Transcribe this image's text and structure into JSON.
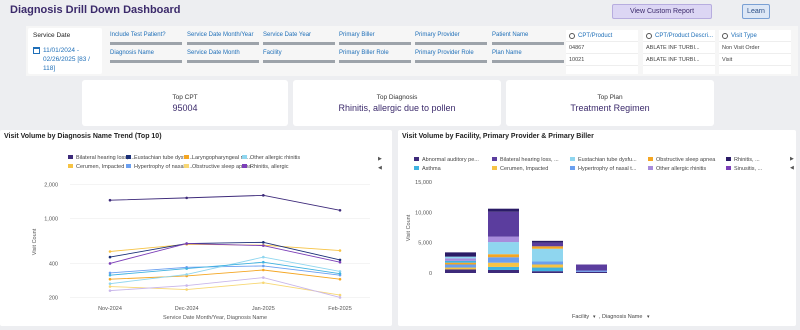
{
  "header": {
    "title": "Diagnosis Drill Down Dashboard",
    "custom_report": "View Custom Report",
    "learn": "Learn"
  },
  "filters": {
    "service_date": {
      "label": "Service Date",
      "value_line1": "11/01/2024 -",
      "value_line2": "02/26/2025 [83 / 118]"
    },
    "row1": [
      "Include Test Patient?",
      "Service Date Month/Year",
      "Service Date Year",
      "Primary Biller",
      "Primary Provider",
      "Patient Name"
    ],
    "row2": [
      "Diagnosis Name",
      "Service Date Month",
      "Facility",
      "Primary Biller Role",
      "Primary Provider Role",
      "Plan Name"
    ],
    "lists": [
      {
        "label": "CPT/Product",
        "items": [
          "04867",
          "10021"
        ]
      },
      {
        "label": "CPT/Product Descri...",
        "items": [
          "ABLATE INF TURBI...",
          "ABLATE INF TURBI..."
        ]
      },
      {
        "label": "Visit Type",
        "items": [
          "Non Visit Order",
          "Visit"
        ]
      }
    ]
  },
  "kpis": [
    {
      "label": "Top CPT",
      "value": "95004"
    },
    {
      "label": "Top Diagnosis",
      "value": "Rhinitis, allergic due to pollen"
    },
    {
      "label": "Top Plan",
      "value": "Treatment Regimen"
    }
  ],
  "colors": {
    "accent": "#3b2a6b",
    "link": "#1f6fb8"
  },
  "chart_data": [
    {
      "type": "line",
      "title": "Visit Volume by Diagnosis Name Trend (Top 10)",
      "xlabel": "Service Date Month/Year, Diagnosis Name",
      "ylabel": "Visit Count",
      "categories": [
        "Nov-2024",
        "Dec-2024",
        "Jan-2025",
        "Feb-2025"
      ],
      "y_ticks": [
        "2,000",
        "1,000",
        "400",
        "200"
      ],
      "scale": "log",
      "ylim": [
        190,
        2100
      ],
      "legend_placement": "top",
      "series": [
        {
          "name": "Bilateral hearing loss, ...",
          "color": "#3d2a7a",
          "values": [
            1450,
            1520,
            1600,
            1180
          ]
        },
        {
          "name": "Cerumen, Impacted",
          "color": "#f6c344",
          "values": [
            510,
            590,
            580,
            520
          ]
        },
        {
          "name": "Eustachian tube dysfu...",
          "color": "#1a2f77",
          "values": [
            455,
            600,
            615,
            430
          ]
        },
        {
          "name": "Hypertrophy of nasal t...",
          "color": "#6a9ff0",
          "values": [
            330,
            370,
            380,
            315
          ]
        },
        {
          "name": "Laryngopharyngeal ref...",
          "color": "#f4a623",
          "values": [
            290,
            310,
            350,
            290
          ]
        },
        {
          "name": "Obstructive sleep apnea",
          "color": "#f7d774",
          "values": [
            250,
            235,
            270,
            210
          ]
        },
        {
          "name": "Other allergic rhinitis",
          "color": "#8fd6ef",
          "values": [
            265,
            320,
            455,
            340
          ]
        },
        {
          "name": "Rhinitis, allergic",
          "color": "#7c3fb8",
          "values": [
            400,
            600,
            575,
            410
          ]
        },
        {
          "name": "",
          "color": "#3fb2e0",
          "values": [
            315,
            360,
            410,
            325
          ]
        },
        {
          "name": "",
          "color": "#c9b7ea",
          "values": [
            230,
            255,
            300,
            200
          ]
        }
      ]
    },
    {
      "type": "bar",
      "title": "Visit Volume by Facility, Primary Provider & Primary Biller",
      "xlabel": "Facility, Diagnosis Name",
      "ylabel": "Visit Count",
      "ylim": [
        0,
        15000
      ],
      "y_ticks": [
        "15,000",
        "10,000",
        "5,000",
        "0"
      ],
      "legend_placement": "top",
      "legend": [
        {
          "name": "Abnormal auditory pe...",
          "color": "#3d2a7a"
        },
        {
          "name": "Asthma",
          "color": "#3fb2e0"
        },
        {
          "name": "Bilateral hearing loss, ...",
          "color": "#5b3d9e"
        },
        {
          "name": "Cerumen, Impacted",
          "color": "#f6c344"
        },
        {
          "name": "Eustachian tube dysfu...",
          "color": "#8fd6ef"
        },
        {
          "name": "Hypertrophy of nasal t...",
          "color": "#6a9ff0"
        },
        {
          "name": "Obstructive sleep apnea",
          "color": "#f4a623"
        },
        {
          "name": "Other allergic rhinitis",
          "color": "#a88cdc"
        },
        {
          "name": "Rhinitis, ...",
          "color": "#2a1b66"
        },
        {
          "name": "Sinusitis, ...",
          "color": "#7c3fb8"
        }
      ],
      "stacks": [
        [
          {
            "color": "#3d2a7a",
            "value": 600
          },
          {
            "color": "#f6c344",
            "value": 300
          },
          {
            "color": "#6a9ff0",
            "value": 500
          },
          {
            "color": "#f4a623",
            "value": 300
          },
          {
            "color": "#3fb2e0",
            "value": 300
          },
          {
            "color": "#a88cdc",
            "value": 400
          },
          {
            "color": "#8fd6ef",
            "value": 300
          },
          {
            "color": "#2a1b66",
            "value": 700
          }
        ],
        [
          {
            "color": "#3d2a7a",
            "value": 500
          },
          {
            "color": "#3fb2e0",
            "value": 500
          },
          {
            "color": "#f6c344",
            "value": 700
          },
          {
            "color": "#6a9ff0",
            "value": 900
          },
          {
            "color": "#f4a623",
            "value": 500
          },
          {
            "color": "#8fd6ef",
            "value": 2000
          },
          {
            "color": "#a88cdc",
            "value": 900
          },
          {
            "color": "#5b3d9e",
            "value": 4100
          },
          {
            "color": "#2a1b66",
            "value": 500
          }
        ],
        [
          {
            "color": "#3d2a7a",
            "value": 300
          },
          {
            "color": "#3fb2e0",
            "value": 600
          },
          {
            "color": "#f6c344",
            "value": 500
          },
          {
            "color": "#6a9ff0",
            "value": 500
          },
          {
            "color": "#8fd6ef",
            "value": 2100
          },
          {
            "color": "#f4a623",
            "value": 400
          },
          {
            "color": "#5b3d9e",
            "value": 600
          },
          {
            "color": "#2a1b66",
            "value": 300
          }
        ],
        [
          {
            "color": "#3d2a7a",
            "value": 200
          },
          {
            "color": "#6a9ff0",
            "value": 200
          },
          {
            "color": "#5b3d9e",
            "value": 1000
          }
        ]
      ]
    }
  ]
}
